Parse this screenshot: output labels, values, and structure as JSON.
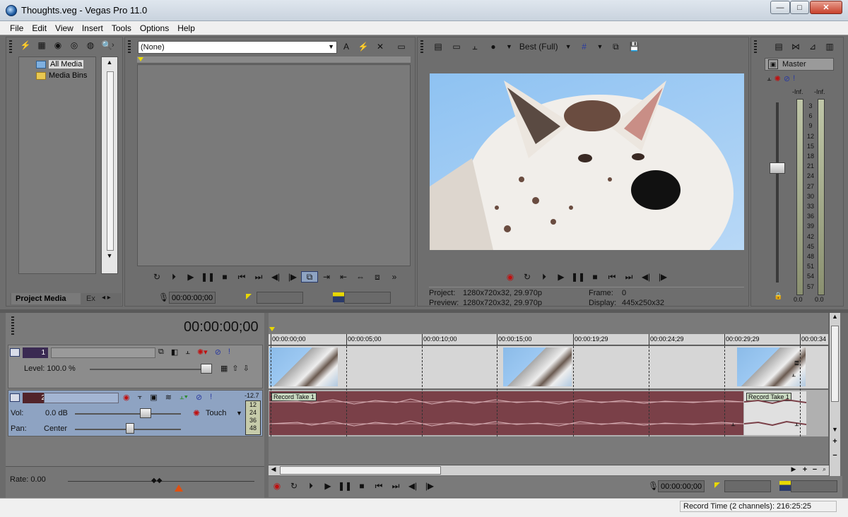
{
  "window": {
    "title": "Thoughts.veg - Vegas Pro 11.0",
    "minimize": "—",
    "maximize": "□",
    "close": "✕"
  },
  "menu": [
    "File",
    "Edit",
    "View",
    "Insert",
    "Tools",
    "Options",
    "Help"
  ],
  "explorer": {
    "tree": [
      "All Media",
      "Media Bins"
    ],
    "tabs": {
      "active": "Project Media",
      "next": "Ex"
    }
  },
  "trimmer": {
    "dropdown": "(None)",
    "timecode": "00:00:00;00"
  },
  "preview": {
    "quality": "Best (Full)",
    "project_label": "Project:",
    "project_value": "1280x720x32, 29.970p",
    "preview_label": "Preview:",
    "preview_value": "1280x720x32, 29.970p",
    "frame_label": "Frame:",
    "frame_value": "0",
    "display_label": "Display:",
    "display_value": "445x250x32"
  },
  "mixer": {
    "master": "Master",
    "inf_left": "-Inf.",
    "inf_right": "-Inf.",
    "ticks": [
      "3",
      "6",
      "9",
      "12",
      "15",
      "18",
      "21",
      "24",
      "27",
      "30",
      "33",
      "36",
      "39",
      "42",
      "45",
      "48",
      "51",
      "54",
      "57"
    ],
    "bottom_left": "0.0",
    "bottom_right": "0.0"
  },
  "timeline": {
    "cursor_time": "00:00:00;00",
    "ruler": [
      "00:00:00;00",
      "00:00:05;00",
      "00:00:10;00",
      "00:00:15;00",
      "00:00:19;29",
      "00:00:24;29",
      "00:00:29;29",
      "00:00:34"
    ],
    "rate": "Rate: 0.00",
    "record_time": "Record Time (2 channels): 216:25:25"
  },
  "tracks": {
    "video": {
      "number": "1",
      "level": "Level: 100.0 %"
    },
    "audio": {
      "number": "2",
      "vol_label": "Vol:",
      "vol_value": "0.0 dB",
      "pan_label": "Pan:",
      "pan_value": "Center",
      "automation": "Touch",
      "peak": "-12.7",
      "meter": [
        "12",
        "24",
        "36",
        "48"
      ]
    }
  },
  "clips": {
    "audio_1": "Record Take 1",
    "audio_2": "Record Take 1"
  },
  "colors": {
    "audio_clip": "#7a4048",
    "video_track": "#d6d6d6",
    "selected_header": "#8ea3c2"
  }
}
